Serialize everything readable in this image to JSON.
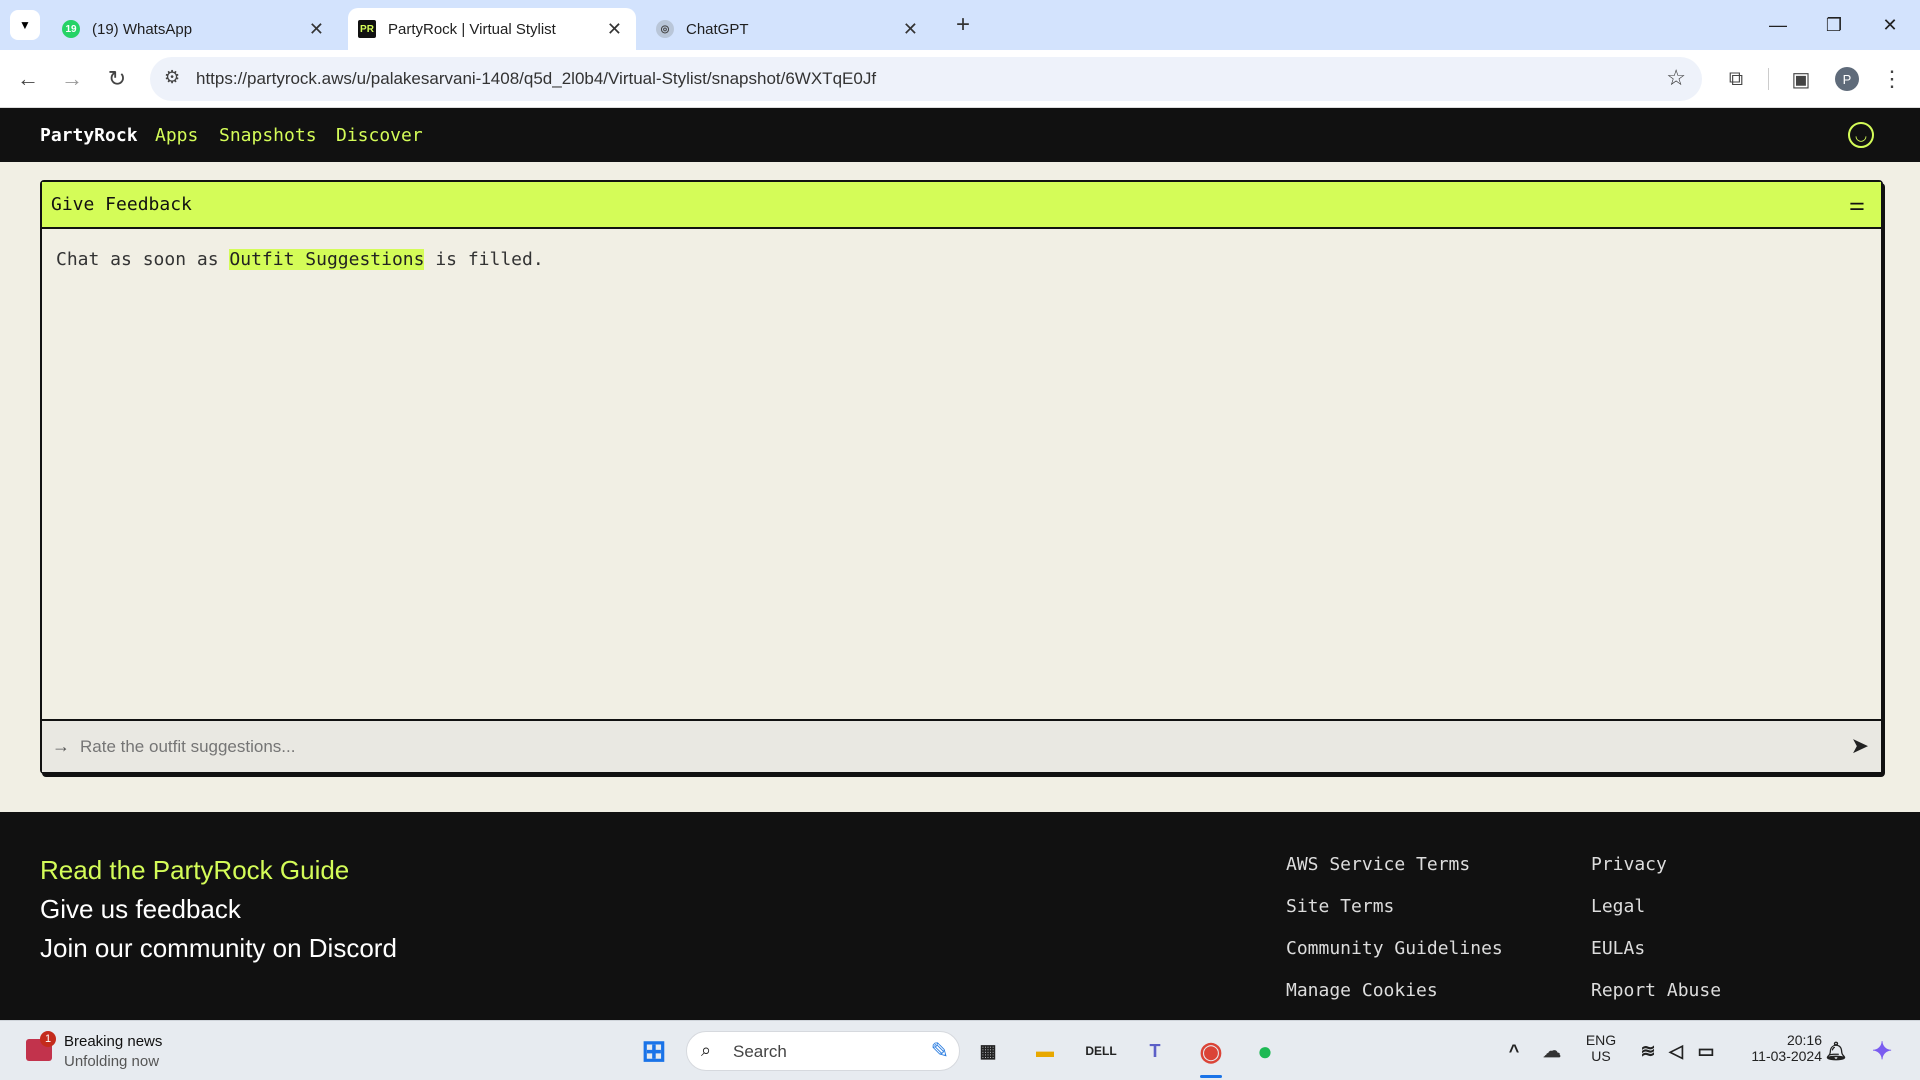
{
  "browser": {
    "tabs": [
      {
        "label": "(19) WhatsApp",
        "favicon": "whatsapp-icon",
        "badge": "19"
      },
      {
        "label": "PartyRock | Virtual Stylist",
        "favicon": "partyrock-icon",
        "favicon_text": "PR"
      },
      {
        "label": "ChatGPT",
        "favicon": "chatgpt-icon"
      }
    ],
    "url": "https://partyrock.aws/u/palakesarvani-1408/q5d_2l0b4/Virtual-Stylist/snapshot/6WXTqE0Jf",
    "profile_initial": "P"
  },
  "app": {
    "brand": "PartyRock",
    "nav": [
      "Apps",
      "Snapshots",
      "Discover"
    ]
  },
  "widget": {
    "title": "Give Feedback",
    "msg_prefix": "Chat as soon as",
    "msg_highlight": "Outfit Suggestions",
    "msg_suffix": "is filled.",
    "input_placeholder": "Rate the outfit suggestions..."
  },
  "footer": {
    "links": [
      "Read the PartyRock Guide",
      "Give us feedback",
      "Join our community on Discord"
    ],
    "col1": [
      "AWS Service Terms",
      "Site Terms",
      "Community Guidelines",
      "Manage Cookies"
    ],
    "col2": [
      "Privacy",
      "Legal",
      "EULAs",
      "Report Abuse"
    ]
  },
  "taskbar": {
    "news_title": "Breaking news",
    "news_sub": "Unfolding now",
    "news_badge": "1",
    "search_placeholder": "Search",
    "lang1": "ENG",
    "lang2": "US",
    "time": "20:16",
    "date": "11-03-2024"
  },
  "colors": {
    "accent": "#d4fc58",
    "dark": "#111111",
    "page_bg": "#f1efe4"
  }
}
